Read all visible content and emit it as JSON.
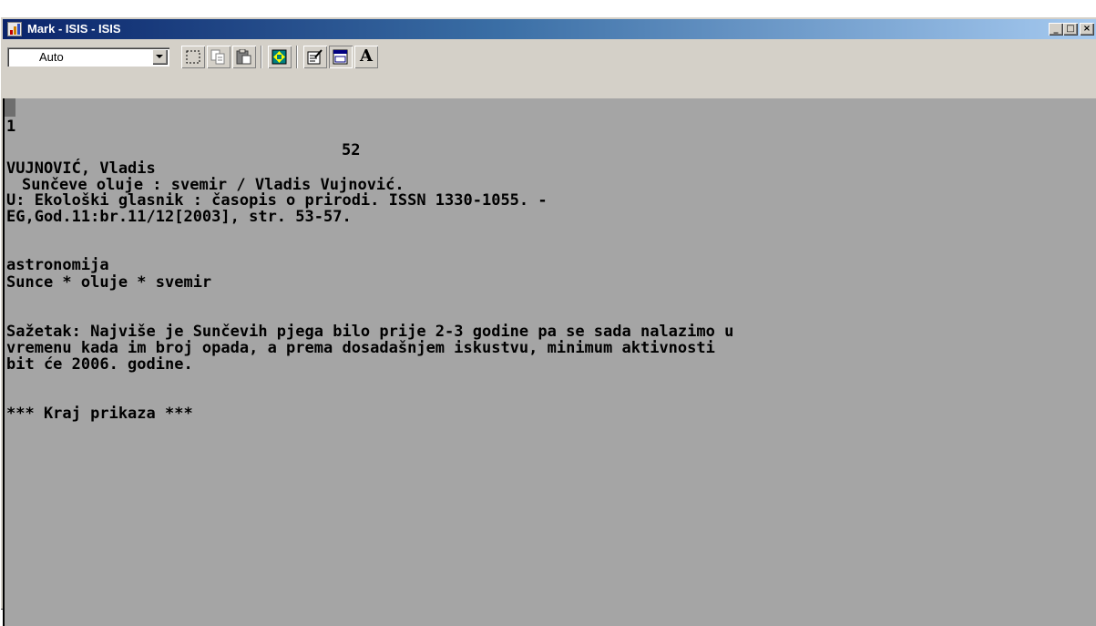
{
  "window": {
    "title": "Mark - ISIS - ISIS",
    "controls": {
      "minimize": "_",
      "maximize": "□",
      "close": "×"
    }
  },
  "toolbar": {
    "zoom_select": {
      "value": "Auto"
    },
    "tools": [
      {
        "name": "select-tool",
        "icon": "select-icon"
      },
      {
        "name": "copy-tool",
        "icon": "copy-icon"
      },
      {
        "name": "paste-tool",
        "icon": "paste-icon"
      },
      {
        "name": "fit-tool",
        "icon": "fit-icon"
      },
      {
        "name": "properties-tool",
        "icon": "properties-icon"
      },
      {
        "name": "window-tool",
        "icon": "window-icon"
      },
      {
        "name": "font-tool",
        "icon": "font-icon",
        "glyph": "A"
      }
    ]
  },
  "record": {
    "mfn": "1",
    "number": "52",
    "author": "VUJNOVIĆ, Vladis",
    "title_line": "Sunčeve oluje : svemir / Vladis Vujnović.",
    "source_line": "U: Ekološki glasnik : časopis o prirodi. ISSN 1330-1055. -",
    "citation_line": "EG,God.11:br.11/12[2003], str. 53-57.",
    "subject": "astronomija",
    "keywords": "Sunce * oluje * svemir",
    "abstract": [
      "Sažetak: Najviše je Sunčevih pjega bilo prije 2-3 godine pa se sada nalazimo u",
      "vremenu kada im broj opada, a prema dosadašnjem iskustvu, minimum aktivnosti",
      "bit će 2006. godine."
    ],
    "end_marker": "*** Kraj prikaza ***"
  },
  "colors": {
    "display_background": "#a5a5a5",
    "titlebar_start": "#0a246a",
    "titlebar_end": "#a6caf0",
    "chrome": "#d4d0c8"
  }
}
